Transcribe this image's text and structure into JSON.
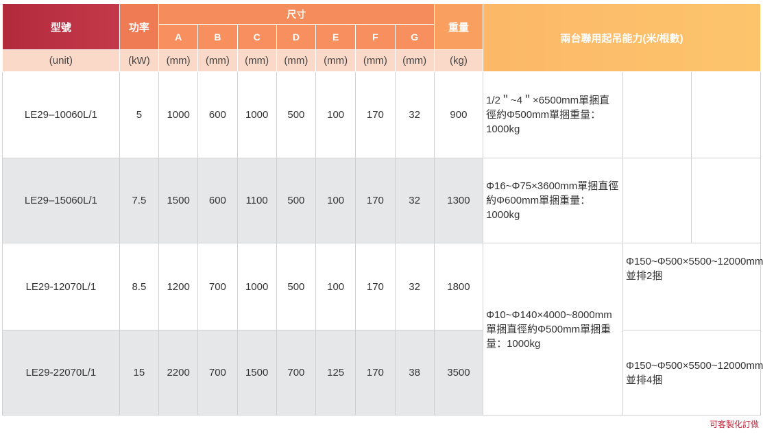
{
  "header": {
    "model": "型號",
    "power": "功率",
    "dimension": "尺寸",
    "weight": "重量",
    "capacity": "兩台聯用起吊能力(米/根數)",
    "dims": [
      "A",
      "B",
      "C",
      "D",
      "E",
      "F",
      "G"
    ]
  },
  "units": {
    "model": "(unit)",
    "power": "(kW)",
    "dims": [
      "(mm)",
      "(mm)",
      "(mm)",
      "(mm)",
      "(mm)",
      "(mm)",
      "(mm)"
    ],
    "weight": "(kg)"
  },
  "rows": [
    {
      "model": "LE29–10060L/1",
      "power": "5",
      "dims": [
        "1000",
        "600",
        "1000",
        "500",
        "100",
        "170",
        "32"
      ],
      "weight": "900"
    },
    {
      "model": "LE29–15060L/1",
      "power": "7.5",
      "dims": [
        "1500",
        "600",
        "1100",
        "500",
        "100",
        "170",
        "32"
      ],
      "weight": "1300"
    },
    {
      "model": "LE29-12070L/1",
      "power": "8.5",
      "dims": [
        "1200",
        "700",
        "1000",
        "500",
        "100",
        "170",
        "32"
      ],
      "weight": "1800"
    },
    {
      "model": "LE29-22070L/1",
      "power": "15",
      "dims": [
        "2200",
        "700",
        "1500",
        "700",
        "125",
        "170",
        "38"
      ],
      "weight": "3500"
    }
  ],
  "capacity_cells": {
    "row1": "1/2＂~4＂×6500mm單捆直徑約Φ500mm單捆重量：1000kg",
    "row2": "Φ16~Φ75×3600mm單捆直徑約Φ600mm單捆重量：1000kg",
    "row34": "Φ10~Φ140×4000~8000mm單捆直徑約Φ500mm單捆重量：1000kg",
    "row3_side": "Φ150~Φ500×5500~12000mm並排2捆",
    "row4_side": "Φ150~Φ500×5500~12000mm並排4捆"
  },
  "footnote": "可客製化訂做"
}
